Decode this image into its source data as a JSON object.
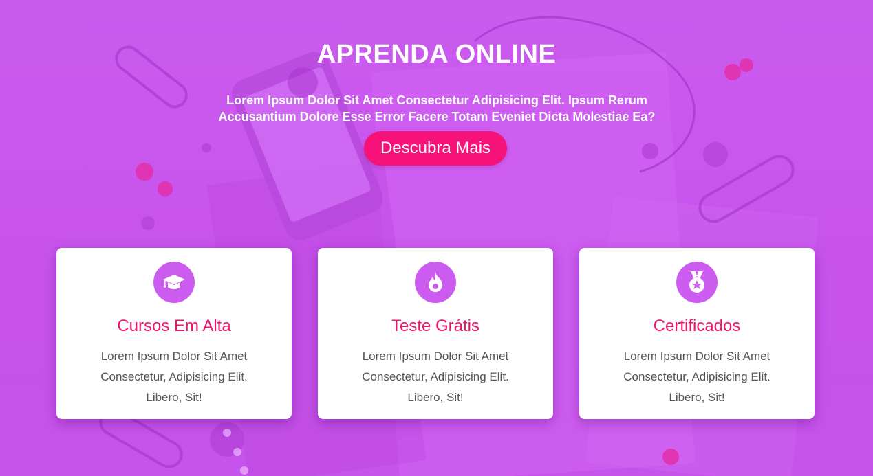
{
  "hero": {
    "title": "APRENDA ONLINE",
    "subtitle": "Lorem Ipsum Dolor Sit Amet Consectetur Adipisicing Elit. Ipsum Rerum Accusantium Dolore Esse Error Facere Totam Eveniet Dicta Molestiae Ea?",
    "cta_label": "Descubra Mais"
  },
  "features": [
    {
      "icon": "graduation-cap-icon",
      "title": "Cursos Em Alta",
      "description": "Lorem Ipsum Dolor Sit Amet Consectetur, Adipisicing Elit. Libero, Sit!"
    },
    {
      "icon": "flame-icon",
      "title": "Teste Grátis",
      "description": "Lorem Ipsum Dolor Sit Amet Consectetur, Adipisicing Elit. Libero, Sit!"
    },
    {
      "icon": "medal-icon",
      "title": "Certificados",
      "description": "Lorem Ipsum Dolor Sit Amet Consectetur, Adipisicing Elit. Libero, Sit!"
    }
  ],
  "colors": {
    "background": "#c957ee",
    "accent": "#f7127a",
    "icon_circle": "#cc5bf0",
    "card_title": "#f0136e"
  }
}
